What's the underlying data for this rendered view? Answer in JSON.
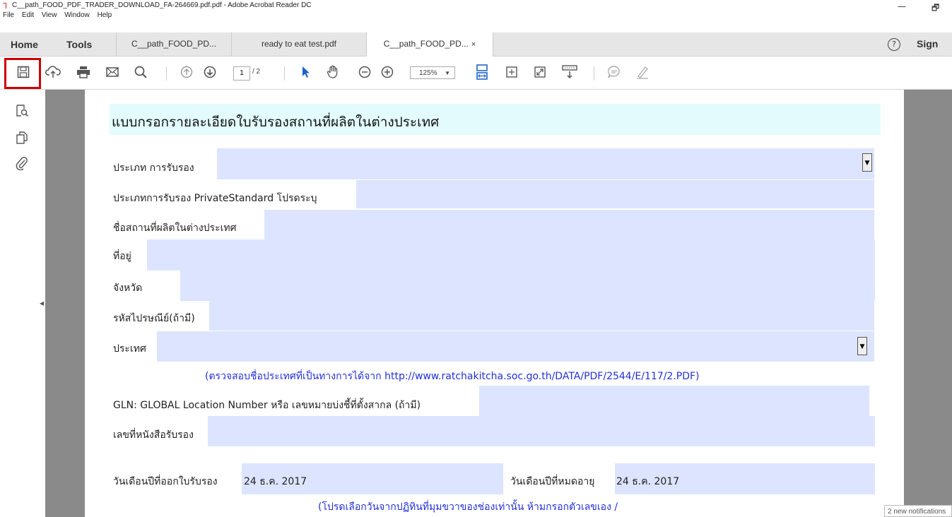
{
  "window": {
    "title": "C__path_FOOD_PDF_TRADER_DOWNLOAD_FA-264669.pdf.pdf - Adobe Acrobat Reader DC",
    "minimize": "—",
    "restore": "🗗"
  },
  "menu": [
    "File",
    "Edit",
    "View",
    "Window",
    "Help"
  ],
  "tabs": {
    "home": "Home",
    "tools": "Tools",
    "docs": [
      {
        "label": "C__path_FOOD_PD...",
        "active": false
      },
      {
        "label": "ready to eat test.pdf",
        "active": false
      },
      {
        "label": "C__path_FOOD_PD...",
        "active": true,
        "close": "×"
      }
    ],
    "help": "?",
    "sign_in": "Sign"
  },
  "toolbar": {
    "page_current": "1",
    "page_total": "/ 2",
    "zoom": "125%",
    "zoom_arrow": "▼",
    "icons": [
      "save-icon",
      "upload-icon",
      "print-icon",
      "email-icon",
      "search-icon",
      "page-up-icon",
      "page-down-icon",
      "select-arrow-icon",
      "hand-icon",
      "zoom-out-icon",
      "zoom-in-icon",
      "fit-width-icon",
      "fit-page-icon",
      "fullscreen-icon",
      "read-mode-icon",
      "comment-icon",
      "highlight-pen-icon"
    ]
  },
  "form": {
    "heading": "แบบกรอกรายละเอียดใบรับรองสถานที่ผลิตในต่างประเทศ",
    "label_cert_type": "ประเภท การรับรอง",
    "label_private_standard": "ประเภทการรับรอง PrivateStandard โปรดระบุ",
    "label_facility_name": "ชื่อสถานที่ผลิตในต่างประเทศ",
    "label_address": "ที่อยู่",
    "label_province": "จังหวัด",
    "label_postcode": "รหัสไปรษณีย์(ถ้ามี)",
    "label_country": "ประเทศ",
    "country_note": "(ตรวจสอบชื่อประเทศที่เป็นทางการได้จาก http://www.ratchakitcha.soc.go.th/DATA/PDF/2544/E/117/2.PDF)",
    "label_gln": "GLN: GLOBAL Location Number หรือ เลขหมายบ่งชี้ที่ตั้งสากล (ถ้ามี)",
    "label_cert_number": "เลขที่หนังสือรับรอง",
    "label_issue_date": "วันเดือนปีที่ออกใบรับรอง",
    "issue_date": "24 ธ.ค. 2017",
    "label_expiry_date": "วันเดือนปีที่หมดอายุ",
    "expiry_date": "24 ธ.ค. 2017",
    "date_note": "(โปรดเลือกวันจากปฏิทินที่มุมขวาของช่องเท่านั้น ห้ามกรอกตัวเลขเอง /",
    "dropdown_arrow": "▼"
  },
  "notification": "2 new notifications"
}
